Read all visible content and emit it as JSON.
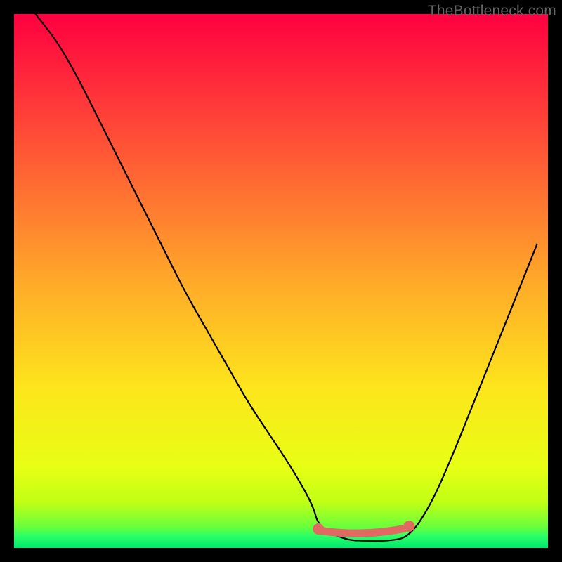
{
  "watermark": "TheBottleneck.com",
  "chart_data": {
    "type": "line",
    "title": "",
    "xlabel": "",
    "ylabel": "",
    "xlim": [
      0,
      100
    ],
    "ylim": [
      0,
      100
    ],
    "x": [
      4,
      8,
      12,
      16,
      20,
      24,
      28,
      32,
      36,
      40,
      44,
      48,
      52,
      56,
      57,
      62,
      66,
      70,
      74,
      78,
      82,
      86,
      90,
      94,
      98
    ],
    "values": [
      100,
      95,
      88,
      80,
      72,
      64,
      56,
      48,
      41,
      34,
      27,
      21,
      15,
      8,
      4,
      1.5,
      1.3,
      1.3,
      2,
      8,
      17,
      27,
      37,
      47,
      57
    ],
    "gradient_stops": [
      {
        "pos": 0.0,
        "color": "#ff0040"
      },
      {
        "pos": 0.25,
        "color": "#ff5436"
      },
      {
        "pos": 0.5,
        "color": "#ffa929"
      },
      {
        "pos": 0.7,
        "color": "#fde51c"
      },
      {
        "pos": 0.85,
        "color": "#e7ff14"
      },
      {
        "pos": 0.915,
        "color": "#bfff15"
      },
      {
        "pos": 0.96,
        "color": "#6bff3b"
      },
      {
        "pos": 0.978,
        "color": "#2aff66"
      },
      {
        "pos": 1.0,
        "color": "#00e86f"
      }
    ],
    "highlight_region": {
      "x_start": 57,
      "x_end": 74,
      "y": 2.5,
      "color": "#e06a62"
    }
  }
}
